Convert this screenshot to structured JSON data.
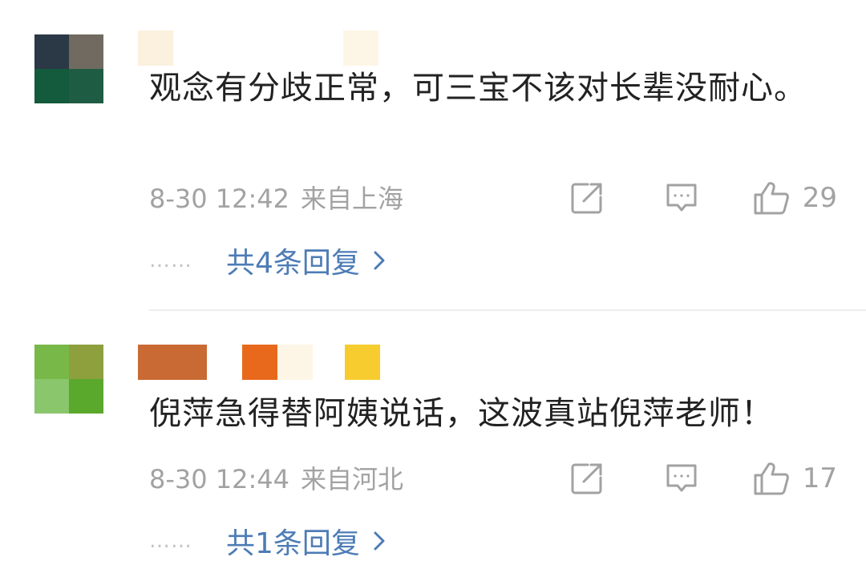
{
  "comments": [
    {
      "text": "观念有分歧正常，可三宝不该对长辈没耐心。",
      "date": "8-30 12:42",
      "location": "来自上海",
      "likes": "29",
      "replies_label": "共4条回复",
      "dots": "……",
      "avatar_colors": [
        "#2b3846",
        "#706a60",
        "#145a3d",
        "#1f5c44"
      ],
      "username_blur_colors": [
        "#fbf1de",
        "#ffffff",
        "#fdf6e6"
      ]
    },
    {
      "text": "倪萍急得替阿姨说话，这波真站倪萍老师！",
      "date": "8-30 12:44",
      "location": "来自河北",
      "likes": "17",
      "replies_label": "共1条回复",
      "dots": "……",
      "avatar_colors": [
        "#78b848",
        "#8e9f3e",
        "#8ac66c",
        "#5aa82c"
      ],
      "username_blur_colors": [
        "#c96a34",
        "#ffffff",
        "#e8691c",
        "#fdf6e6",
        "#f6cc2e"
      ]
    }
  ],
  "icons": {
    "share": "share-icon",
    "comment": "comment-icon",
    "like": "thumbs-up-icon",
    "chevron": "chevron-right-icon"
  },
  "colors": {
    "text": "#222222",
    "meta": "#a2a2a2",
    "link": "#4d7cb6",
    "divider": "#ededed"
  }
}
